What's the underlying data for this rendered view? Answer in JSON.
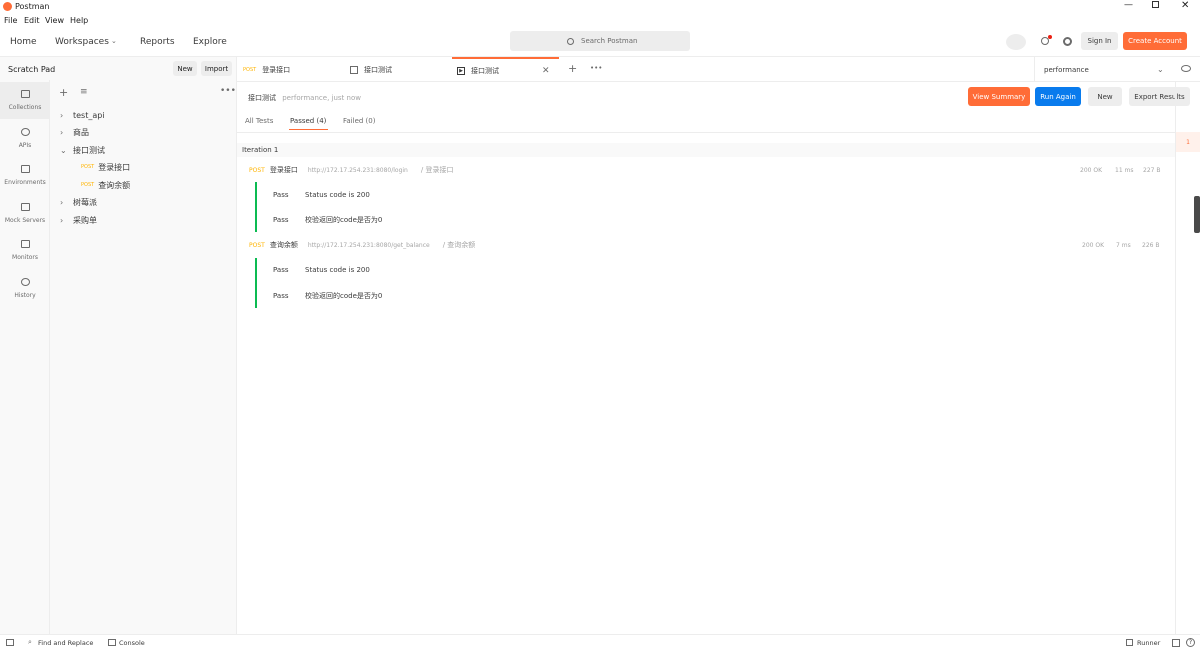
{
  "window": {
    "title": "Postman"
  },
  "menu": [
    "File",
    "Edit",
    "View",
    "Help"
  ],
  "appbar": {
    "home": "Home",
    "workspaces": "Workspaces",
    "reports": "Reports",
    "explore": "Explore",
    "search_placeholder": "Search Postman",
    "sign_in": "Sign In",
    "create_account": "Create Account"
  },
  "sidebar": {
    "title": "Scratch Pad",
    "new_label": "New",
    "import_label": "Import",
    "rail": [
      "Collections",
      "APIs",
      "Environments",
      "Mock Servers",
      "Monitors",
      "History"
    ],
    "tree": [
      {
        "label": "test_api",
        "expanded": false
      },
      {
        "label": "商品",
        "expanded": false
      },
      {
        "label": "接口测试",
        "expanded": true,
        "children": [
          {
            "method": "POST",
            "label": "登录接口"
          },
          {
            "method": "POST",
            "label": "查询余额"
          }
        ]
      },
      {
        "label": "树莓派",
        "expanded": false
      },
      {
        "label": "采购单",
        "expanded": false
      }
    ]
  },
  "tabs": [
    {
      "method": "POST",
      "label": "登录接口",
      "active": false
    },
    {
      "label": "接口测试",
      "active": false
    },
    {
      "label": "接口测试",
      "active": true
    }
  ],
  "environment": "performance",
  "runner": {
    "collection": "接口测试",
    "meta": "performance, just now",
    "view_summary": "View Summary",
    "run_again": "Run Again",
    "new_label": "New",
    "export_results": "Export Results",
    "filters": {
      "all": "All Tests",
      "passed": "Passed (4)",
      "failed": "Failed (0)"
    },
    "iteration_label": "Iteration 1",
    "iteration_num": "1",
    "requests": [
      {
        "method": "POST",
        "name": "登录接口",
        "url": "http://172.17.254.231:8080/login",
        "path": "/ 登录接口",
        "status": "200 OK",
        "time": "11 ms",
        "size": "227 B",
        "tests": [
          {
            "result": "Pass",
            "name": "Status code is 200"
          },
          {
            "result": "Pass",
            "name": "校验返回的code是否为0"
          }
        ]
      },
      {
        "method": "POST",
        "name": "查询余额",
        "url": "http://172.17.254.231:8080/get_balance",
        "path": "/ 查询余额",
        "status": "200 OK",
        "time": "7 ms",
        "size": "226 B",
        "tests": [
          {
            "result": "Pass",
            "name": "Status code is 200"
          },
          {
            "result": "Pass",
            "name": "校验返回的code是否为0"
          }
        ]
      }
    ]
  },
  "statusbar": {
    "find_replace": "Find and Replace",
    "console": "Console",
    "runner": "Runner"
  },
  "colors": {
    "accent": "#ff6c37",
    "blue": "#097bed",
    "pass": "#0cbb52",
    "post": "#ffb400"
  }
}
